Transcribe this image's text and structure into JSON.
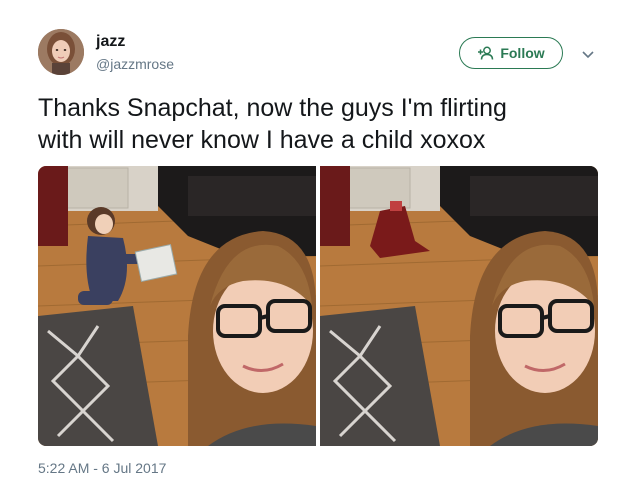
{
  "user": {
    "display_name": "jazz",
    "handle": "@jazzmrose",
    "avatar_icon": "profile-photo"
  },
  "actions": {
    "follow_label": "Follow",
    "follow_icon": "add-user-icon",
    "menu_icon": "chevron-down-icon"
  },
  "tweet": {
    "text": "Thanks Snapchat, now the guys I'm flirting\nwith will never know I have a child xoxox",
    "timestamp": "5:22 AM - 6 Jul 2017"
  },
  "media": {
    "photos": [
      {
        "label": "photo-with-child"
      },
      {
        "label": "photo-child-removed"
      }
    ]
  },
  "colors": {
    "accent": "#2b7a54",
    "text": "#14171a",
    "secondary": "#657786"
  }
}
